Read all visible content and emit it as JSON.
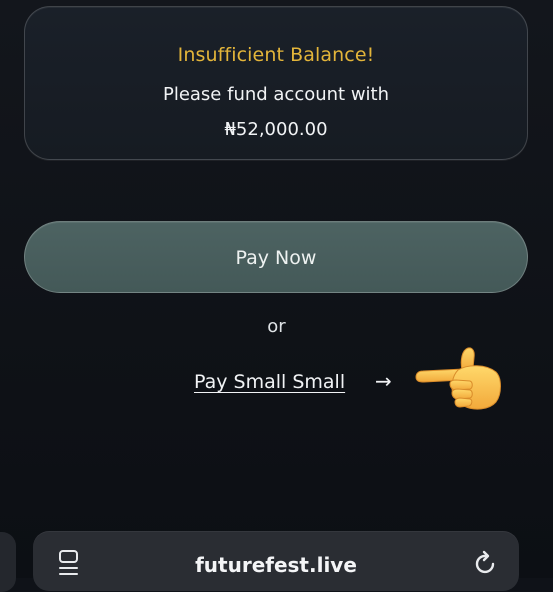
{
  "balance_card": {
    "title": "Insufficient Balance!",
    "message": "Please fund account with",
    "amount": "₦52,000.00"
  },
  "pay_now": {
    "label": "Pay Now"
  },
  "separator": {
    "text": "or"
  },
  "pay_small": {
    "label": "Pay Small Small",
    "arrow": "→",
    "pointer_icon": "pointing-hand-emoji"
  },
  "browser_bar": {
    "url": "futurefest.live",
    "left_icon": "reader-icon",
    "right_icon": "reload-icon"
  },
  "colors": {
    "accent_gold": "#e3b53a",
    "button_teal": "#4d6362",
    "background": "#0f1218"
  }
}
